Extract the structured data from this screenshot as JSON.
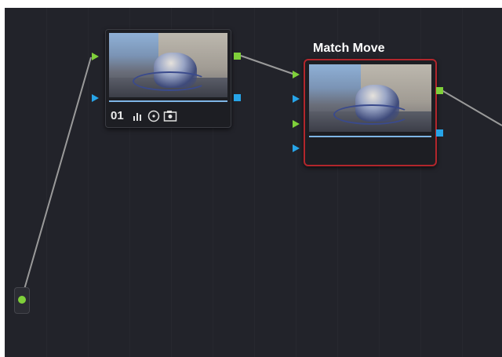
{
  "node_editor": {
    "nodes": [
      {
        "number": "01",
        "label": "",
        "selected": false,
        "tools": [
          "histogram-icon",
          "circle-icon",
          "camera-icon"
        ]
      },
      {
        "number": "",
        "label": "Match Move",
        "selected": true
      }
    ],
    "colors": {
      "rgb_port": "#7fd03a",
      "alpha_port": "#27a4e8",
      "selection_border": "#b2262c",
      "wire": "#9a9a9a",
      "background": "#22232a"
    }
  }
}
